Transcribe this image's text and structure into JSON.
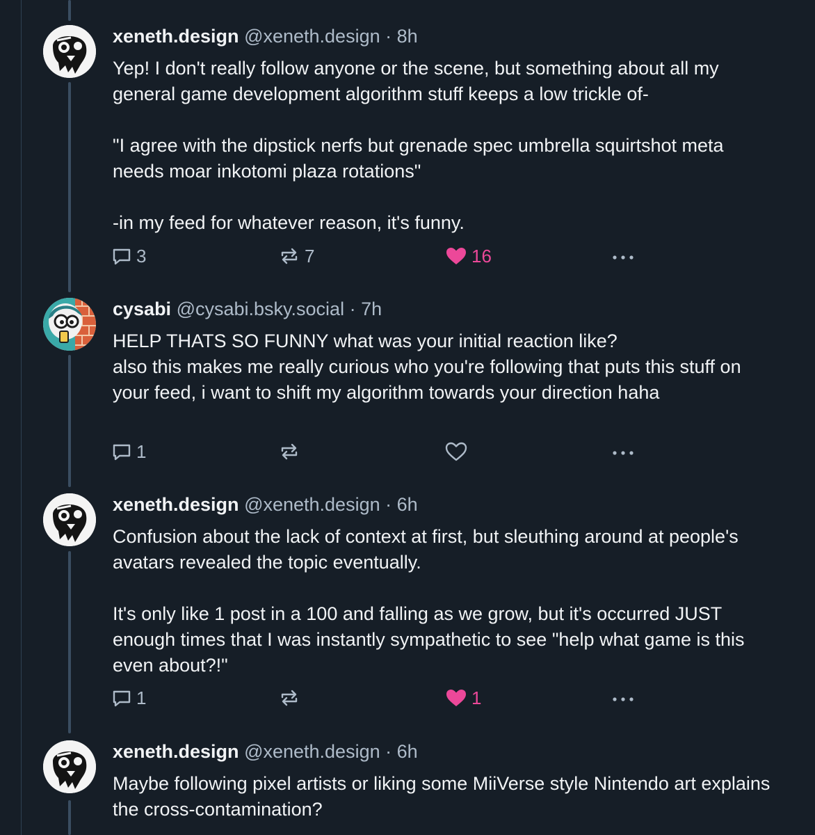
{
  "colors": {
    "background": "#161e27",
    "text": "#f1f3f5",
    "muted": "#aebbc9",
    "like_active": "#ec4899",
    "thread_line": "#3a4d61"
  },
  "posts": [
    {
      "display_name": "xeneth.design",
      "handle": "@xeneth.design",
      "separator": "·",
      "time": "8h",
      "avatar": "skull-art-avatar",
      "text": "Yep! I don't really follow anyone or the scene, but something about all my general game development algorithm stuff keeps a low trickle of-\n\n\"I agree with the dipstick nerfs but grenade spec umbrella squirtshot meta needs moar inkotomi plaza rotations\"\n\n-in my feed for whatever reason, it's funny.",
      "replies": "3",
      "reposts": "7",
      "likes": "16",
      "liked": true
    },
    {
      "display_name": "cysabi",
      "handle": "@cysabi.bsky.social",
      "separator": "·",
      "time": "7h",
      "avatar": "cartoon-character-avatar",
      "text": "HELP THATS SO FUNNY what was your initial reaction like?\nalso this makes me really curious who you're following that puts this stuff on your feed, i want to shift my algorithm towards your direction haha",
      "replies": "1",
      "reposts": "",
      "likes": "",
      "liked": false
    },
    {
      "display_name": "xeneth.design",
      "handle": "@xeneth.design",
      "separator": "·",
      "time": "6h",
      "avatar": "skull-art-avatar",
      "text": "Confusion about the lack of context at first, but sleuthing around at people's avatars revealed the topic eventually.\n\nIt's only like 1 post in a 100 and falling as we grow, but it's occurred JUST enough times that I was instantly sympathetic to see \"help what game is this even about?!\"",
      "replies": "1",
      "reposts": "",
      "likes": "1",
      "liked": true
    },
    {
      "display_name": "xeneth.design",
      "handle": "@xeneth.design",
      "separator": "·",
      "time": "6h",
      "avatar": "skull-art-avatar",
      "text": "Maybe following pixel artists or liking some MiiVerse style Nintendo art explains the cross-contamination?"
    }
  ]
}
